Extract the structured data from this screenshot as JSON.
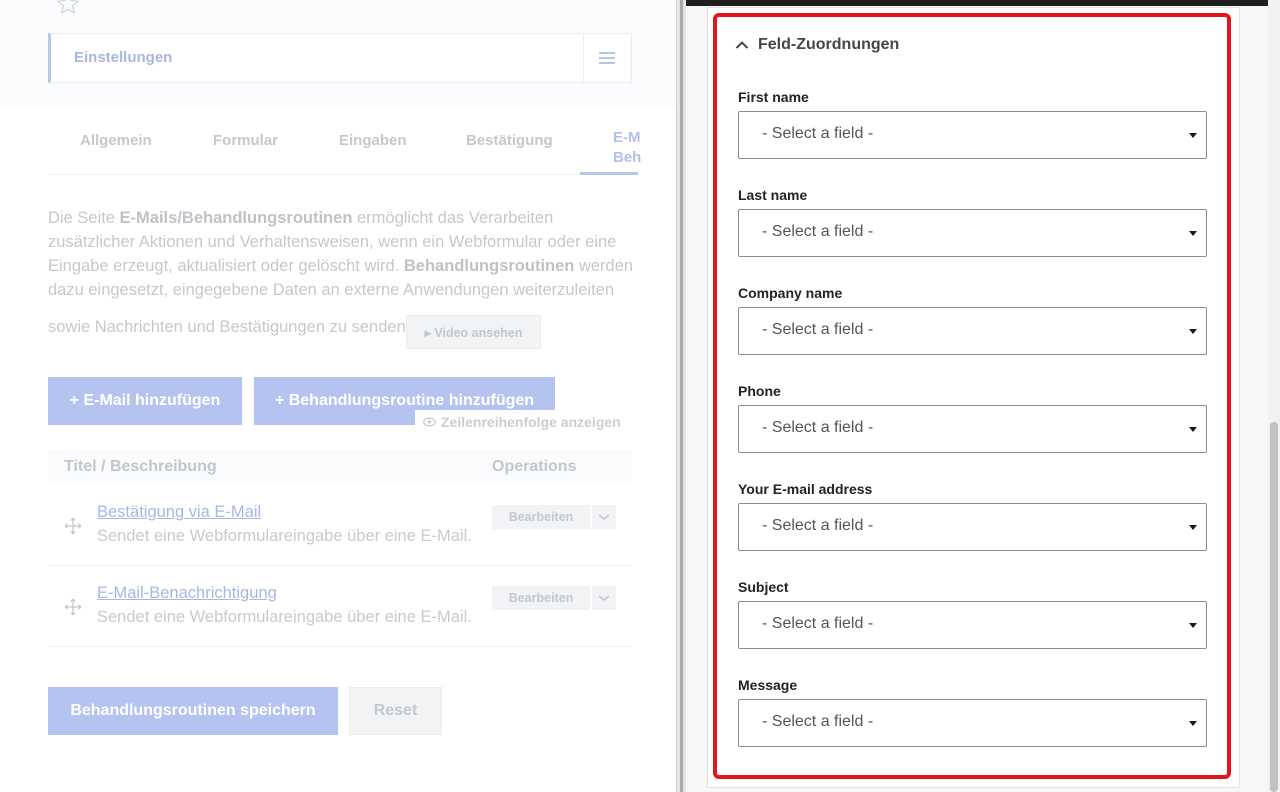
{
  "left": {
    "settings_label": "Einstellungen",
    "tabs": [
      {
        "label": "Allgemein"
      },
      {
        "label": "Formular"
      },
      {
        "label": "Eingaben"
      },
      {
        "label": "Bestätigung"
      },
      {
        "label_line1": "E-M",
        "label_line2": "Beh"
      }
    ],
    "description": {
      "p1_a": "Die Seite ",
      "p1_b": "E-Mails/Behandlungsroutinen",
      "p1_c": " ermöglicht das Verarbeiten zusätzlicher Aktionen und Verhaltensweisen, wenn ein Webformular oder eine Eingabe erzeugt, aktualisiert oder gelöscht wird. ",
      "p1_d": "Behandlungsroutinen",
      "p1_e": " werden dazu eingesetzt, eingegebene Daten an externe Anwendungen weiterzuleiten",
      "p2": "sowie Nachrichten und Bestätigungen zu senden."
    },
    "video_button": "▸ Video ansehen",
    "add_email": "+ E-Mail hinzufügen",
    "add_handler": "+ Behandlungsroutine hinzufügen",
    "row_order": "Zeilenreihenfolge anzeigen",
    "table": {
      "col_title": "Titel / Beschreibung",
      "col_ops": "Operations",
      "rows": [
        {
          "title": "Bestätigung via E-Mail",
          "desc": "Sendet eine Webformulareingabe über eine E-Mail.",
          "edit": "Bearbeiten"
        },
        {
          "title": "E-Mail-Benachrichtigung",
          "desc": "Sendet eine Webformulareingabe über eine E-Mail.",
          "edit": "Bearbeiten"
        }
      ]
    },
    "save_button": "Behandlungsroutinen speichern",
    "reset_button": "Reset"
  },
  "right": {
    "section_title": "Feld-Zuordnungen",
    "fields": [
      {
        "label": "First name",
        "value": "- Select a field -"
      },
      {
        "label": "Last name",
        "value": "- Select a field -"
      },
      {
        "label": "Company name",
        "value": "- Select a field -"
      },
      {
        "label": "Phone",
        "value": "- Select a field -"
      },
      {
        "label": "Your E-mail address",
        "value": "- Select a field -"
      },
      {
        "label": "Subject",
        "value": "- Select a field -"
      },
      {
        "label": "Message",
        "value": "- Select a field -"
      }
    ]
  },
  "colors": {
    "highlight": "#e3141b",
    "accent_dimmed": "#b5c3f0"
  }
}
